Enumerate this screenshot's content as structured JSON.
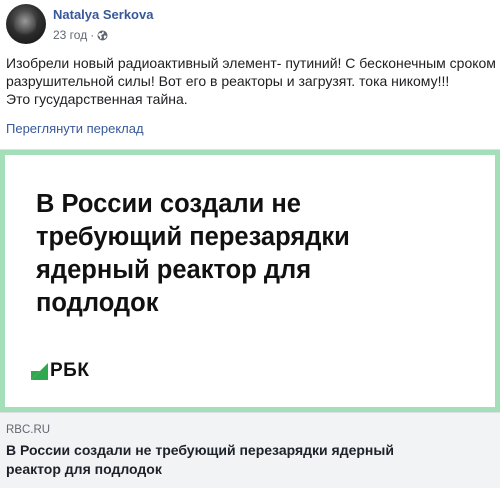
{
  "post": {
    "author": "Natalya Serkova",
    "time": "23 год",
    "separator": "·",
    "privacy_icon": "globe-icon",
    "text_lines": [
      "Изобрели новый радиоактивный элемент- путиний! С бесконечным сроком",
      "разрушительной силы! Вот его в реакторы и загрузят. тока никому!!!",
      "Это гусударственная тайна."
    ],
    "translate_label": "Переглянути переклад"
  },
  "link_card": {
    "image": {
      "border_color": "#a5dfb9",
      "headline_lines": [
        "В России создали не",
        "требующий перезарядки",
        "ядерный реактор для",
        "подлодок"
      ],
      "logo_text": "РБК",
      "logo_color": "#2fa84f"
    },
    "domain": "RBC.RU",
    "title_lines": [
      "В России создали не требующий перезарядки ядерный",
      "реактор для подлодок"
    ]
  },
  "colors": {
    "link": "#385898",
    "footer_bg": "#f2f3f5",
    "text": "#1c1e21"
  }
}
